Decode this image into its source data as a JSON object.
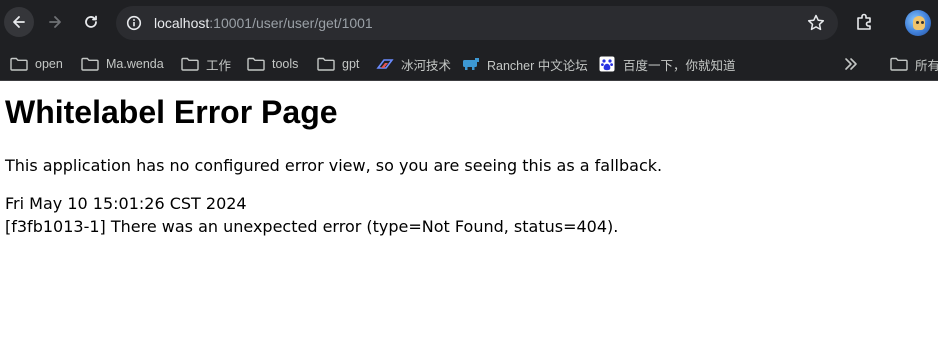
{
  "browser": {
    "url_host": "localhost",
    "url_rest": ":10001/user/user/get/1001"
  },
  "bookmarks": [
    {
      "label": "open",
      "icon": "folder-icon"
    },
    {
      "label": "Ma.wenda",
      "icon": "folder-icon"
    },
    {
      "label": "工作",
      "icon": "folder-icon"
    },
    {
      "label": "tools",
      "icon": "folder-icon"
    },
    {
      "label": "gpt",
      "icon": "folder-icon"
    },
    {
      "label": "冰河技术",
      "icon": "site-favicon"
    },
    {
      "label": "Rancher 中文论坛",
      "icon": "rancher-favicon"
    },
    {
      "label": "百度一下，你就知道",
      "icon": "baidu-favicon"
    }
  ],
  "bookmarks_other": {
    "label": "所有",
    "icon": "folder-icon"
  },
  "page": {
    "title": "Whitelabel Error Page",
    "description": "This application has no configured error view, so you are seeing this as a fallback.",
    "timestamp": "Fri May 10 15:01:26 CST 2024",
    "error_message": "[f3fb1013-1] There was an unexpected error (type=Not Found, status=404)."
  },
  "colors": {
    "chrome_bg": "#1f2023",
    "omnibox_bg": "#2b2c30",
    "text_light": "#e8eaed",
    "text_dim": "#9aa0a6"
  }
}
